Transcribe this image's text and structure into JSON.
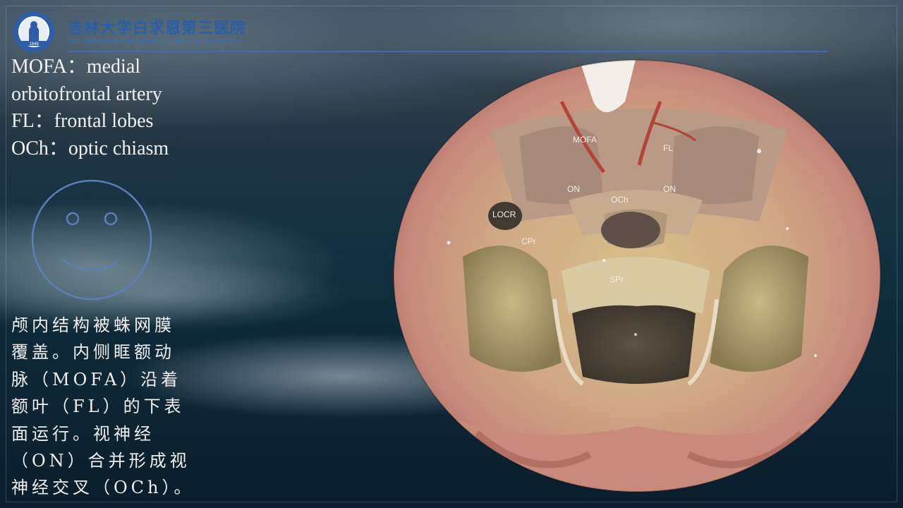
{
  "header": {
    "hospital_name_cn": "吉林大学白求恩第三医院",
    "hospital_name_en": "THE THIRD BETHUNE HOSPITAL OF JILIN UNIVERSITY",
    "logo_year": "1949",
    "accent_color": "#3f6db5"
  },
  "legend": {
    "items": [
      "MOFA：medial",
      "orbitofrontal artery",
      "FL：frontal lobes",
      "OCh：optic chiasm"
    ]
  },
  "caption": {
    "lines": [
      "颅内结构被蛛网膜",
      "覆盖。内侧眶额动",
      "脉（MOFA）沿着",
      "额叶（FL）的下表",
      "面运行。视神经",
      "（ON）合并形成视",
      "神经交叉（OCh）。"
    ]
  },
  "figure": {
    "labels": {
      "mofa": "MOFA",
      "fl": "FL",
      "on_left": "ON",
      "on_right": "ON",
      "och": "OCh",
      "locr": "LOCR",
      "cpr": "CPr",
      "spr": "SPr"
    }
  },
  "decoration": {
    "smiley_icon": "smiley-face-icon"
  }
}
